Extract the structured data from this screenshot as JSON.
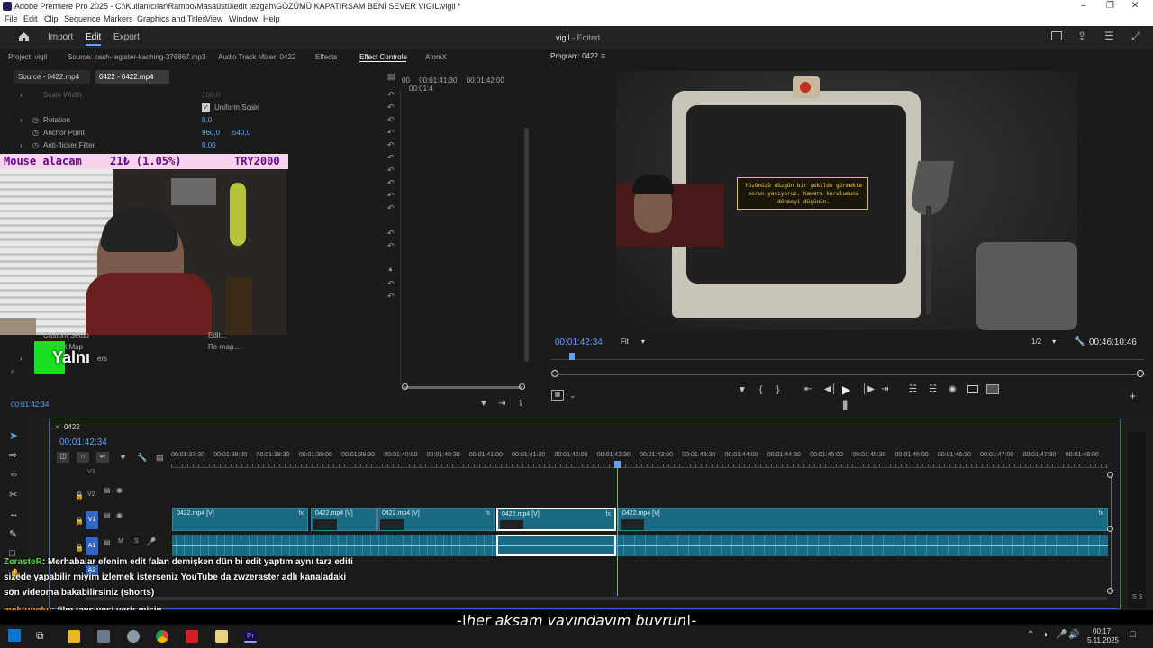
{
  "window": {
    "title": "Adobe Premiere Pro 2025 - C:\\Kullanıcılar\\Rambo\\Masaüstü\\edit tezgah\\GÖZÜMÜ KAPATIRSAM BENİ SEVER VIGIL\\vigil *"
  },
  "menu": [
    "File",
    "Edit",
    "Clip",
    "Sequence",
    "Markers",
    "Graphics and Titles",
    "View",
    "Window",
    "Help"
  ],
  "header": {
    "home": "home",
    "import": "Import",
    "edit": "Edit",
    "export": "Export",
    "project_title": "vigil",
    "status": "- Edited"
  },
  "left_tabs": [
    "Project: vigil",
    "Source: cash-register-kaching-376867.mp3",
    "Audio Track Mixer: 0422",
    "Effects",
    "Effect Controls",
    "AtomX"
  ],
  "source_tabs": [
    "Source - 0422.mp4",
    "0422 - 0422.mp4"
  ],
  "mini_timecodes": [
    "00",
    "00:01:41:30",
    "00:01:42:00",
    "00:01:4"
  ],
  "effect_props": [
    {
      "label": "Scale Width",
      "value": "100,0"
    },
    {
      "label": "Uniform Scale",
      "value": ""
    },
    {
      "label": "Rotation",
      "value": "0,0"
    },
    {
      "label": "Anchor Point",
      "value": "960,0",
      "value2": "540,0"
    },
    {
      "label": "Anti-flicker Filter",
      "value": "0,00"
    }
  ],
  "effect_more": {
    "custom_setup": "Custom Setup",
    "edit": "Edit...",
    "map": "t Map",
    "remap": "Re-map...",
    "other": "ers"
  },
  "left_timecode": "00:01:42:34",
  "overlay": {
    "donation_user": "Mouse alacam",
    "donation_amount": "21₺ (1.05%)",
    "donation_currency": "TRY2000",
    "name_tag": "Yalnı"
  },
  "program": {
    "tab": "Program: 0422",
    "timecode": "00:01:42:34",
    "fit": "Fit",
    "resolution": "1/2",
    "duration": "00:46:10:46",
    "video_text": "Yüzünüzü düzgün bir şekilde görmekte sorun yaşıyoruz. Kamera kurulumuna dönmeyi düşünün."
  },
  "timeline": {
    "tab": "0422",
    "timecode": "00:01:42:34",
    "ruler": [
      "00:01:37:30",
      "00:01:38:00",
      "00:01:38:30",
      "00:01:39:00",
      "00:01:39:30",
      "00:01:40:00",
      "00:01:40:30",
      "00:01:41:00",
      "00:01:41:30",
      "00:01:42:00",
      "00:01:42:30",
      "00:01:43:00",
      "00:01:43:30",
      "00:01:44:00",
      "00:01:44:30",
      "00:01:45:00",
      "00:01:45:30",
      "00:01:46:00",
      "00:01:46:30",
      "00:01:47:00",
      "00:01:47:30",
      "00:01:48:00"
    ],
    "tracks": {
      "v3": "V3",
      "v2": "V2",
      "v1": "V1",
      "a1": "A1",
      "a2": "A2"
    },
    "clips": [
      "0422.mp4 [V]",
      "0422.mp4 [V]",
      "0422.mp4 [V]",
      "0422.mp4 [V]",
      "0422.mp4 [V]"
    ],
    "track_toggles": {
      "m": "M",
      "s": "S"
    }
  },
  "chat": [
    {
      "user": "ZerasteR",
      "message": ": Merhabalar efenim edit falan demişken dün bi edit yaptım aynı tarz editi"
    },
    {
      "user": "",
      "message": "sizede yapabilir miyim izlemek isterseniz YouTube da zwzeraster adlı kanaladaki"
    },
    {
      "user": "",
      "message": "son videoma bakabilirsiniz (shorts)"
    },
    {
      "user": "mektupoku",
      "message": ": film tavsiyesi verir misin"
    }
  ],
  "subtitle": "-|her akşam yayındayım buyrun|-",
  "taskbar": {
    "time": "00:17",
    "date": "5.11.2025"
  },
  "colors": {
    "accent": "#2e66c5",
    "clip": "#1b6a84",
    "timecode": "#5aa3ff",
    "donation_bg": "#f8d4ec",
    "name_tag_bg": "#18e020"
  }
}
